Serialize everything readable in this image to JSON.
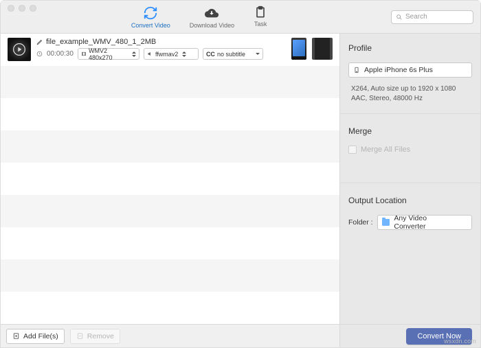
{
  "toolbar": {
    "items": [
      {
        "label": "Convert Video"
      },
      {
        "label": "Download Video"
      },
      {
        "label": "Task"
      }
    ],
    "search_placeholder": "Search"
  },
  "file": {
    "name": "file_example_WMV_480_1_2MB",
    "duration": "00:00:30",
    "video_codec": "WMV2 480x270",
    "audio_codec": "ffwmav2",
    "subtitle": "no subtitle",
    "subtitle_prefix": "CC"
  },
  "sidebar": {
    "profile_title": "Profile",
    "profile_value": "Apple iPhone 6s Plus",
    "profile_detail_line1": "X264, Auto size up to 1920 x 1080",
    "profile_detail_line2": "AAC, Stereo, 48000 Hz",
    "merge_title": "Merge",
    "merge_label": "Merge All Files",
    "output_title": "Output Location",
    "folder_label": "Folder :",
    "folder_value": "Any Video Converter"
  },
  "footer": {
    "add_label": "Add File(s)",
    "remove_label": "Remove",
    "convert_label": "Convert Now"
  },
  "watermark": "wsxdn.com"
}
